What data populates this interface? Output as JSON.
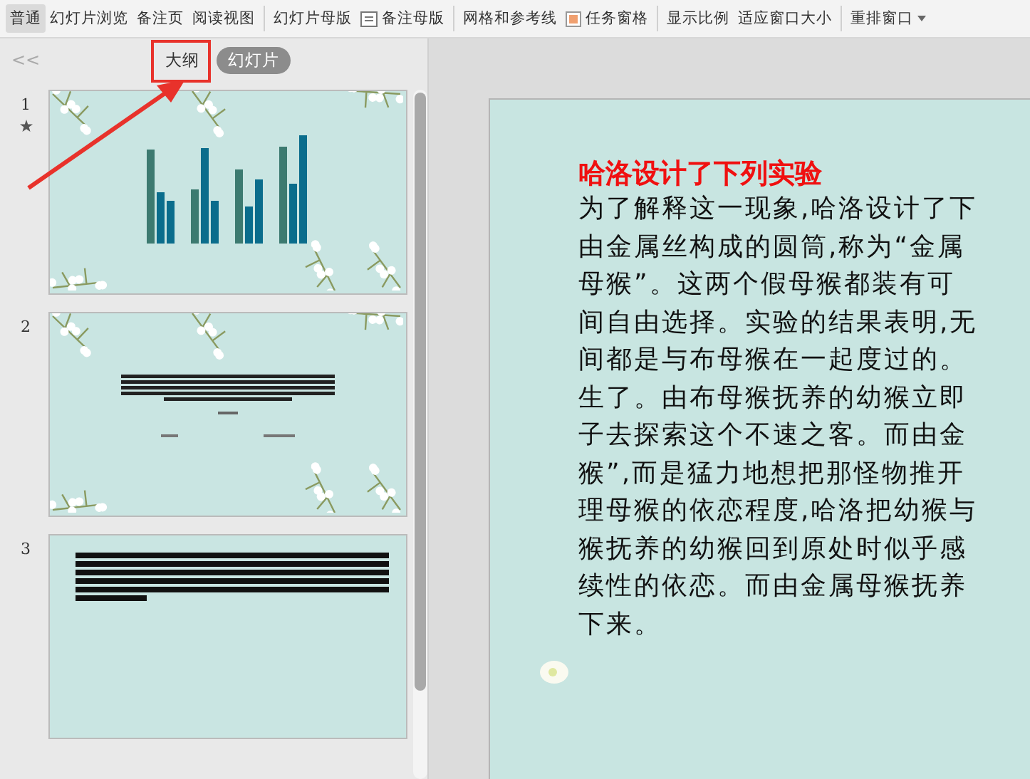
{
  "toolbar": {
    "items": [
      {
        "label": "普通",
        "kind": "view",
        "selected": true
      },
      {
        "label": "幻灯片浏览",
        "kind": "view",
        "selected": false
      },
      {
        "label": "备注页",
        "kind": "view",
        "selected": false
      },
      {
        "label": "阅读视图",
        "kind": "view",
        "selected": false
      },
      {
        "kind": "separator"
      },
      {
        "label": "幻灯片母版",
        "kind": "plain"
      },
      {
        "label": "备注母版",
        "kind": "icon"
      },
      {
        "kind": "separator"
      },
      {
        "label": "网格和参考线",
        "kind": "plain"
      },
      {
        "label": "任务窗格",
        "kind": "check",
        "checked": true
      },
      {
        "kind": "separator"
      },
      {
        "label": "显示比例",
        "kind": "plain"
      },
      {
        "label": "适应窗口大小",
        "kind": "plain"
      },
      {
        "kind": "separator"
      },
      {
        "label": "重排窗口",
        "kind": "dropdown"
      }
    ]
  },
  "panel": {
    "collapse": "<<",
    "tabs": [
      {
        "label": "大纲",
        "selected": false
      },
      {
        "label": "幻灯片",
        "selected": true
      }
    ],
    "slides": [
      {
        "number": "1",
        "kind": "chart",
        "animated": true
      },
      {
        "number": "2",
        "kind": "title"
      },
      {
        "number": "3",
        "kind": "text"
      }
    ]
  },
  "slide": {
    "title": "哈洛设计了下列实验",
    "lines": [
      "为了解释这一现象,哈洛设计了下",
      "由金属丝构成的圆筒,称为“金属",
      "母猴”。这两个假母猴都装有可",
      "间自由选择。实验的结果表明,无",
      "间都是与布母猴在一起度过的。",
      "生了。由布母猴抚养的幼猴立即",
      "子去探索这个不速之客。而由金",
      "猴”,而是猛力地想把那怪物推开",
      "理母猴的依恋程度,哈洛把幼猴与",
      "猴抚养的幼猴回到原处时似乎感",
      "续性的依恋。而由金属母猴抚养",
      "下来。"
    ]
  }
}
